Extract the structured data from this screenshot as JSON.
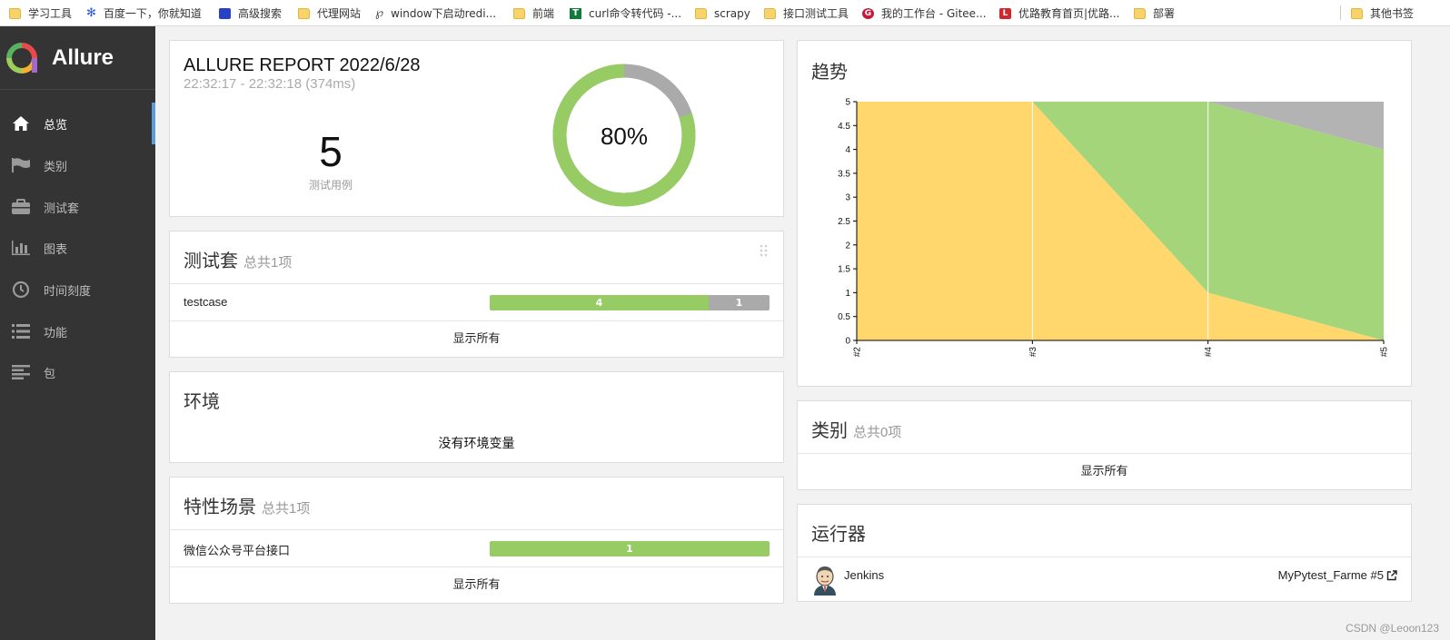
{
  "bookmarks": [
    {
      "label": "学习工具",
      "icon": "folder-icon"
    },
    {
      "label": "百度一下，你就知道",
      "icon": "baidu-paw-icon"
    },
    {
      "label": "高级搜索",
      "icon": "search-engine-icon"
    },
    {
      "label": "代理网站",
      "icon": "folder-icon"
    },
    {
      "label": "window下启动redi...",
      "icon": "v-site-icon"
    },
    {
      "label": "前端",
      "icon": "folder-icon"
    },
    {
      "label": "curl命令转代码 -...",
      "icon": "t-site-icon"
    },
    {
      "label": "scrapy",
      "icon": "folder-icon"
    },
    {
      "label": "接口测试工具",
      "icon": "folder-icon"
    },
    {
      "label": "我的工作台 - Gitee...",
      "icon": "gitee-icon"
    },
    {
      "label": "优路教育首页|优路...",
      "icon": "youlu-icon"
    },
    {
      "label": "部署",
      "icon": "folder-icon"
    },
    {
      "label": "其他书签",
      "icon": "folder-icon"
    }
  ],
  "sidebar": {
    "brand": "Allure",
    "items": [
      {
        "label": "总览",
        "icon": "home-icon",
        "active": true
      },
      {
        "label": "类别",
        "icon": "flag-icon"
      },
      {
        "label": "测试套",
        "icon": "briefcase-icon"
      },
      {
        "label": "图表",
        "icon": "bar-chart-icon"
      },
      {
        "label": "时间刻度",
        "icon": "clock-icon"
      },
      {
        "label": "功能",
        "icon": "list-icon"
      },
      {
        "label": "包",
        "icon": "align-left-icon"
      }
    ]
  },
  "summary": {
    "title": "ALLURE REPORT 2022/6/28",
    "time": "22:32:17 - 22:32:18 (374ms)",
    "count": "5",
    "count_label": "测试用例",
    "percent": "80%",
    "passed_fraction": 0.8,
    "colors": {
      "passed": "#97cc64",
      "unknown": "#aaaaaa"
    }
  },
  "suites": {
    "title": "测试套",
    "subtitle": "总共1项",
    "rows": [
      {
        "name": "testcase",
        "passed": "4",
        "unknown": "1"
      }
    ],
    "show_all": "显示所有"
  },
  "environment": {
    "title": "环境",
    "empty": "没有环境变量"
  },
  "features": {
    "title": "特性场景",
    "subtitle": "总共1项",
    "rows": [
      {
        "name": "微信公众号平台接口",
        "passed": "1"
      }
    ],
    "show_all": "显示所有"
  },
  "trend": {
    "title": "趋势"
  },
  "categories": {
    "title": "类别",
    "subtitle": "总共0项",
    "show_all": "显示所有"
  },
  "executors": {
    "title": "运行器",
    "name": "Jenkins",
    "build": "MyPytest_Farme #5"
  },
  "watermark": "CSDN @Leoon123",
  "chart_data": {
    "type": "area",
    "x": [
      "#2",
      "#3",
      "#4",
      "#5"
    ],
    "ylim": [
      0,
      5
    ],
    "yticks": [
      "0",
      "0.5",
      "1",
      "1.5",
      "2",
      "2.5",
      "3",
      "3.5",
      "4",
      "4.5",
      "5"
    ],
    "series": [
      {
        "color": "#ffd76c",
        "values": [
          5,
          5,
          1,
          0
        ]
      },
      {
        "color": "#a4d57b",
        "values": [
          0,
          0,
          4,
          4
        ]
      },
      {
        "color": "#b3b3b3",
        "values": [
          0,
          0,
          0,
          1
        ]
      }
    ]
  }
}
